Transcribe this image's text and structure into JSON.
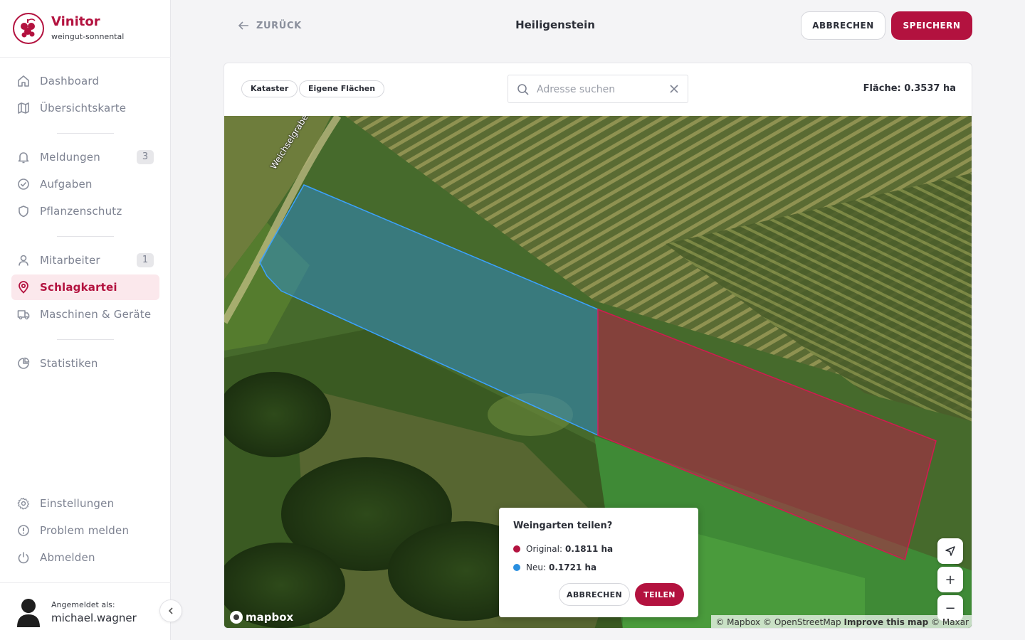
{
  "brand": {
    "name": "Vinitor",
    "subtitle": "weingut-sonnental"
  },
  "nav": {
    "dashboard": "Dashboard",
    "overview_map": "Übersichtskarte",
    "messages": "Meldungen",
    "messages_count": "3",
    "tasks": "Aufgaben",
    "plant_protection": "Pflanzenschutz",
    "staff": "Mitarbeiter",
    "staff_count": "1",
    "field_register": "Schlagkartei",
    "machines": "Maschinen & Geräte",
    "statistics": "Statistiken",
    "settings": "Einstellungen",
    "report_problem": "Problem melden",
    "logout": "Abmelden"
  },
  "user": {
    "logged_in_label": "Angemeldet als:",
    "username": "michael.wagner"
  },
  "header": {
    "back_label": "ZURÜCK",
    "title": "Heiligenstein",
    "cancel_label": "ABBRECHEN",
    "save_label": "SPEICHERN"
  },
  "toolbar": {
    "chip_cadastre": "Kataster",
    "chip_own_areas": "Eigene Flächen",
    "search_placeholder": "Adresse suchen",
    "area_text": "Fläche: 0.3537 ha"
  },
  "map": {
    "road_label": "Weichselgraben",
    "brand_logo": "mapbox",
    "attribution": {
      "mapbox": "© Mapbox",
      "osm": "© OpenStreetMap",
      "improve": "Improve this map",
      "maxar": "© Maxar"
    },
    "controls": {
      "locate_icon": "navigation-arrow-icon",
      "zoom_in": "+",
      "zoom_out": "−"
    }
  },
  "popup": {
    "title": "Weingarten teilen?",
    "original_label": "Original:",
    "original_value": "0.1811 ha",
    "new_label": "Neu:",
    "new_value": "0.1721 ha",
    "cancel_label": "ABBRECHEN",
    "split_label": "TEILEN"
  },
  "colors": {
    "accent": "#b3123f",
    "original_polygon": "#c2174a",
    "new_polygon": "#2a8fe0"
  }
}
